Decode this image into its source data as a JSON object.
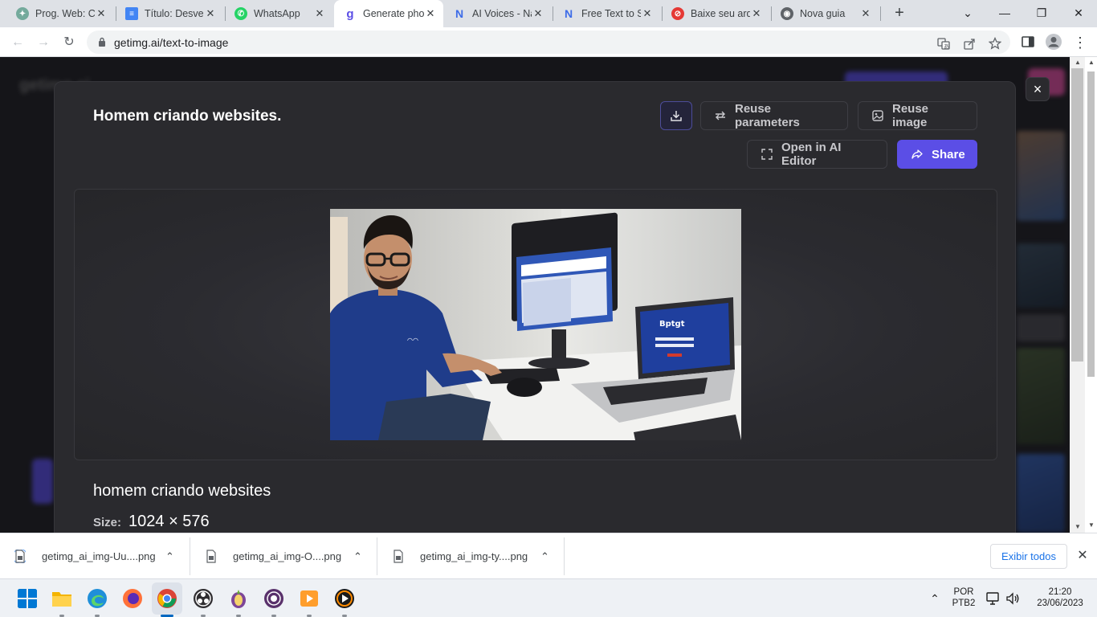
{
  "browser": {
    "tabs": [
      {
        "title": "Prog. Web: Cr",
        "icon": "chatgpt-icon"
      },
      {
        "title": "Título: Desver",
        "icon": "google-docs-icon"
      },
      {
        "title": "WhatsApp",
        "icon": "whatsapp-icon"
      },
      {
        "title": "Generate pho",
        "icon": "getimg-icon",
        "active": true
      },
      {
        "title": "AI Voices - Na",
        "icon": "n-icon"
      },
      {
        "title": "Free Text to S",
        "icon": "n-icon"
      },
      {
        "title": "Baixe seu arq",
        "icon": "download-site-icon"
      },
      {
        "title": "Nova guia",
        "icon": "chrome-icon"
      }
    ],
    "url": "getimg.ai/text-to-image"
  },
  "background_site": {
    "logo": "getimg.ai"
  },
  "modal": {
    "title": "Homem criando websites.",
    "buttons": {
      "download_icon": "download-icon",
      "reuse_parameters": "Reuse parameters",
      "reuse_image": "Reuse image",
      "open_editor": "Open in AI Editor",
      "share": "Share"
    },
    "prompt": "homem criando websites",
    "size_label": "Size:",
    "size_value": "1024 × 576",
    "close": "×"
  },
  "downloads": {
    "items": [
      {
        "name": "getimg_ai_img-Uu....png"
      },
      {
        "name": "getimg_ai_img-O....png"
      },
      {
        "name": "getimg_ai_img-ty....png"
      }
    ],
    "show_all": "Exibir todos"
  },
  "taskbar": {
    "language_line1": "POR",
    "language_line2": "PTB2",
    "time": "21:20",
    "date": "23/06/2023"
  },
  "colors": {
    "accent": "#5b4ee6",
    "modal_bg": "#2a2a2e",
    "chrome_blue": "#1a73e8"
  }
}
